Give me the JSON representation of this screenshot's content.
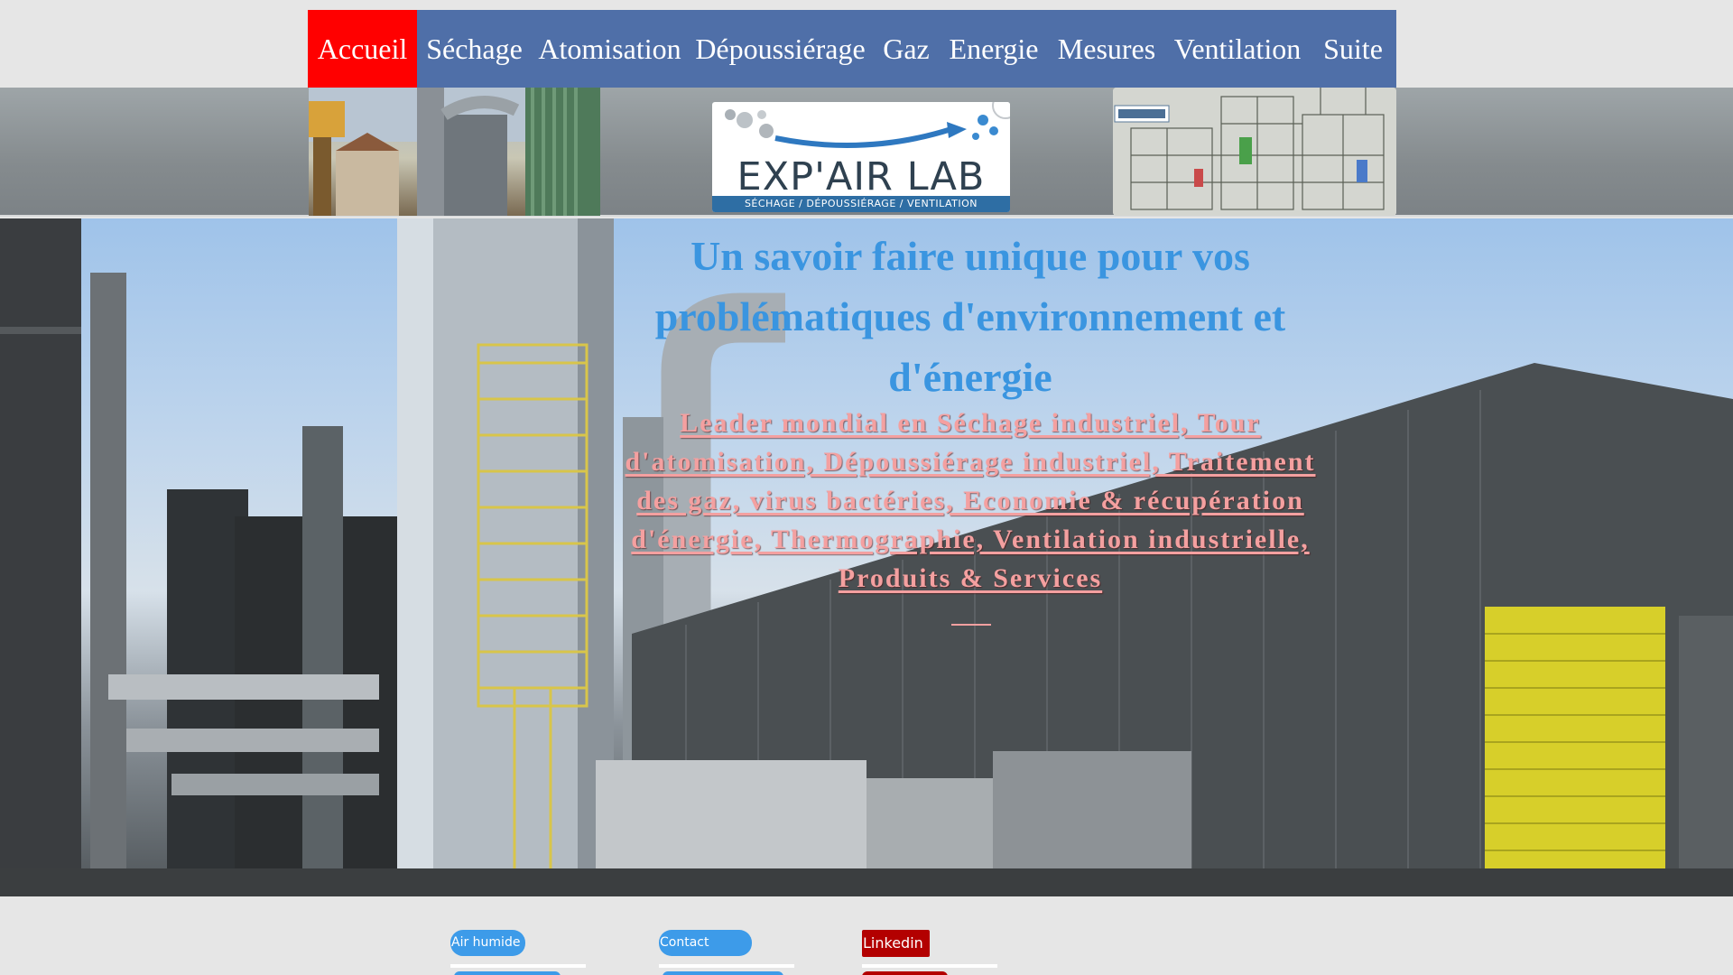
{
  "nav": {
    "items": [
      {
        "label": "Accueil",
        "active": true
      },
      {
        "label": "Séchage",
        "active": false
      },
      {
        "label": "Atomisation",
        "active": false
      },
      {
        "label": "Dépoussiérage",
        "active": false
      },
      {
        "label": "Gaz",
        "active": false
      },
      {
        "label": "Energie",
        "active": false
      },
      {
        "label": "Mesures",
        "active": false
      },
      {
        "label": "Ventilation",
        "active": false
      },
      {
        "label": "Suite",
        "active": false
      }
    ]
  },
  "banner": {
    "logo_name": "EXP'AIR LAB",
    "logo_tagline": "SÉCHAGE / DÉPOUSSIÉRAGE / VENTILATION"
  },
  "hero": {
    "title": "Un savoir faire unique pour vos problématiques d'environnement et d'énergie",
    "subtitle": "Leader mondial en Séchage industriel, Tour d'atomisation, Dépoussiérage industriel, Traitement des gaz, virus bactéries, Economie & récupération d'énergie, Thermographie, Ventilation industrielle, Produits & Services"
  },
  "footer": {
    "air_humide": "Air humide",
    "contact": "Contact",
    "linkedin": "Linkedin"
  },
  "colors": {
    "nav_bg": "#4f6fa8",
    "nav_active": "#ff0000",
    "hero_title": "#3a95e0",
    "hero_subtitle": "#f4a0a0",
    "pill_blue": "#3d9be9",
    "linkedin_red": "#b30000"
  }
}
